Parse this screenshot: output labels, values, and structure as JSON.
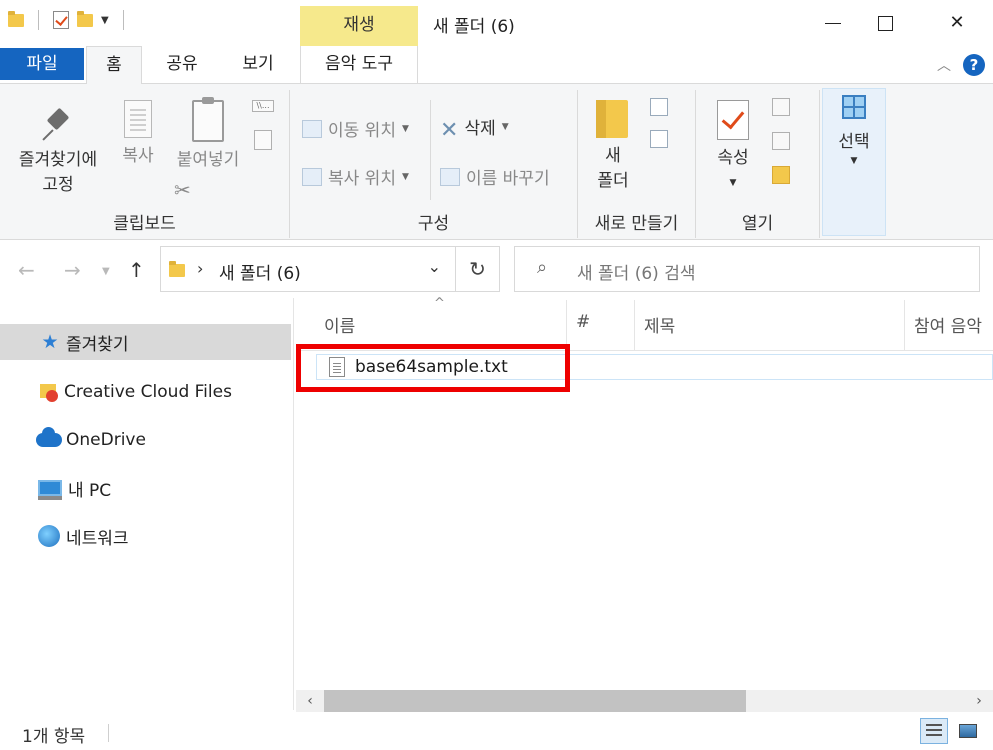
{
  "window": {
    "title": "새 폴더 (6)",
    "context_tab": "재생"
  },
  "ribbon_tabs": {
    "file": "파일",
    "home": "홈",
    "share": "공유",
    "view": "보기",
    "music_tools": "음악 도구"
  },
  "ribbon": {
    "clipboard": {
      "group_label": "클립보드",
      "pin_line1": "즐겨찾기에",
      "pin_line2": "고정",
      "copy": "복사",
      "paste": "붙여넣기"
    },
    "organize": {
      "group_label": "구성",
      "move_to": "이동 위치",
      "copy_to": "복사 위치",
      "delete": "삭제",
      "rename": "이름 바꾸기"
    },
    "new": {
      "group_label": "새로 만들기",
      "new_folder_line1": "새",
      "new_folder_line2": "폴더"
    },
    "open": {
      "group_label": "열기",
      "properties": "속성"
    },
    "select": {
      "label": "선택"
    }
  },
  "address": {
    "crumb": "새 폴더 (6)",
    "search_placeholder": "새 폴더 (6) 검색"
  },
  "nav": {
    "items": [
      {
        "label": "즐겨찾기",
        "icon": "star-icon",
        "selected": true
      },
      {
        "label": "Creative Cloud Files",
        "icon": "creative-cloud-icon"
      },
      {
        "label": "OneDrive",
        "icon": "onedrive-icon"
      },
      {
        "label": "내 PC",
        "icon": "pc-icon"
      },
      {
        "label": "네트워크",
        "icon": "network-icon"
      }
    ]
  },
  "columns": {
    "name": "이름",
    "number": "#",
    "title": "제목",
    "artist": "참여 음악"
  },
  "files": [
    {
      "name": "base64sample.txt",
      "icon": "text-file-icon",
      "highlighted": true
    }
  ],
  "status": {
    "count": "1개 항목"
  },
  "colors": {
    "file_tab": "#1565c0",
    "context_tab": "#f6e98c",
    "highlight_box": "#ee0000"
  }
}
